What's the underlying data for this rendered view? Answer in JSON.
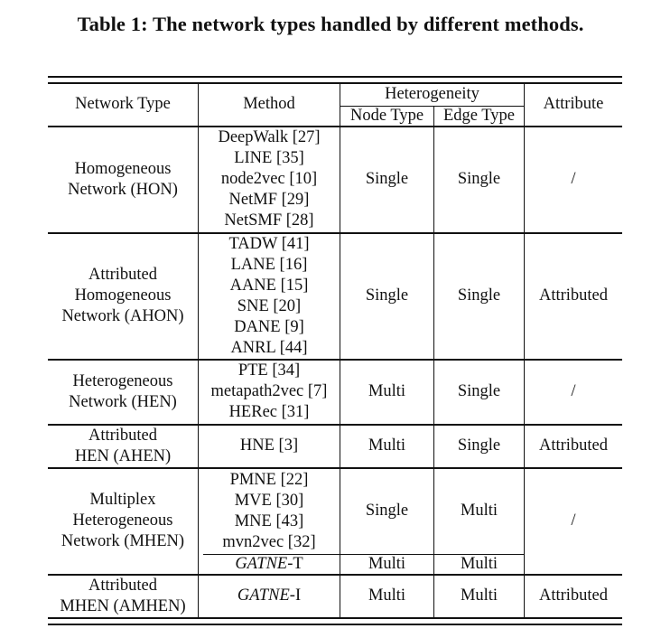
{
  "caption": "Table 1:  The network types handled by different methods.",
  "header": {
    "network_type": "Network Type",
    "method": "Method",
    "heterogeneity": "Heterogeneity",
    "node_type": "Node Type",
    "edge_type": "Edge Type",
    "attribute": "Attribute"
  },
  "rows": [
    {
      "network_type": [
        "Homogeneous",
        "Network (HON)"
      ],
      "methods": [
        "DeepWalk [27]",
        "LINE [35]",
        "node2vec [10]",
        "NetMF [29]",
        "NetSMF [28]"
      ],
      "node_type": "Single",
      "edge_type": "Single",
      "attribute": "/"
    },
    {
      "network_type": [
        "Attributed",
        "Homogeneous",
        "Network (AHON)"
      ],
      "methods": [
        "TADW [41]",
        "LANE [16]",
        "AANE [15]",
        "SNE [20]",
        "DANE [9]",
        "ANRL [44]"
      ],
      "node_type": "Single",
      "edge_type": "Single",
      "attribute": "Attributed"
    },
    {
      "network_type": [
        "Heterogeneous",
        "Network (HEN)"
      ],
      "methods": [
        "PTE [34]",
        "metapath2vec [7]",
        "HERec [31]"
      ],
      "node_type": "Multi",
      "edge_type": "Single",
      "attribute": "/"
    },
    {
      "network_type": [
        "Attributed",
        "HEN (AHEN)"
      ],
      "methods": [
        "HNE [3]"
      ],
      "node_type": "Multi",
      "edge_type": "Single",
      "attribute": "Attributed"
    },
    {
      "network_type": [
        "Multiplex",
        "Heterogeneous",
        "Network (MHEN)"
      ],
      "methods": [
        "PMNE [22]",
        "MVE [30]",
        "MNE [43]",
        "mvn2vec [32]"
      ],
      "node_type": "Single",
      "edge_type": "Multi",
      "attribute": "/",
      "sub": {
        "method_italic": "GATNE",
        "method_suffix": "-T",
        "node_type": "Multi",
        "edge_type": "Multi"
      }
    },
    {
      "network_type": [
        "Attributed",
        "MHEN (AMHEN)"
      ],
      "method_italic": "GATNE",
      "method_suffix": "-I",
      "node_type": "Multi",
      "edge_type": "Multi",
      "attribute": "Attributed"
    }
  ]
}
